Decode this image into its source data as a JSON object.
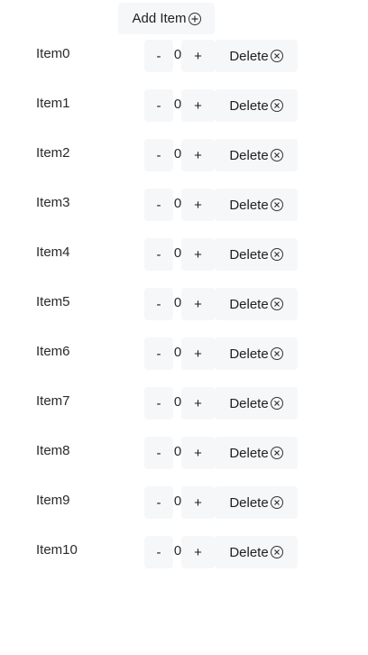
{
  "header": {
    "add_label": "Add Item"
  },
  "items": [
    {
      "label": "Item0",
      "count": "0"
    },
    {
      "label": "Item1",
      "count": "0"
    },
    {
      "label": "Item2",
      "count": "0"
    },
    {
      "label": "Item3",
      "count": "0"
    },
    {
      "label": "Item4",
      "count": "0"
    },
    {
      "label": "Item5",
      "count": "0"
    },
    {
      "label": "Item6",
      "count": "0"
    },
    {
      "label": "Item7",
      "count": "0"
    },
    {
      "label": "Item8",
      "count": "0"
    },
    {
      "label": "Item9",
      "count": "0"
    },
    {
      "label": "Item10",
      "count": "0"
    }
  ],
  "controls": {
    "minus_label": "-",
    "plus_label": "+",
    "delete_label": "Delete"
  },
  "icons": {
    "add": "plus-circle-icon",
    "delete": "close-circle-icon"
  }
}
